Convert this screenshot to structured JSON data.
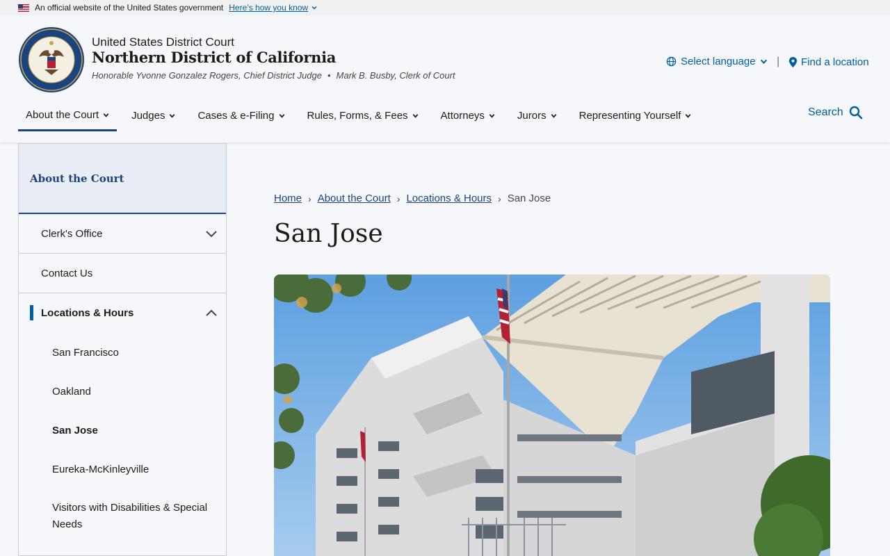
{
  "gov_banner": {
    "text": "An official website of the United States government",
    "link": "Here’s how you know"
  },
  "header": {
    "court_line": "United States District Court",
    "court_name": "Northern District of California",
    "judge": "Honorable Yvonne Gonzalez Rogers, Chief District Judge",
    "dot": "•",
    "clerk": "Mark B. Busby, Clerk of Court",
    "language": "Select language",
    "divider": "|",
    "find_location": "Find a location",
    "search": "Search"
  },
  "nav": {
    "items": [
      {
        "label": "About the Court"
      },
      {
        "label": "Judges"
      },
      {
        "label": "Cases & e-Filing"
      },
      {
        "label": "Rules, Forms, & Fees"
      },
      {
        "label": "Attorneys"
      },
      {
        "label": "Jurors"
      },
      {
        "label": "Representing Yourself"
      }
    ]
  },
  "sidebar": {
    "heading": "About the Court",
    "items": [
      {
        "label": "Clerk's Office"
      },
      {
        "label": "Contact Us"
      },
      {
        "label": "Locations & Hours"
      }
    ],
    "sub_items": [
      {
        "label": "San Francisco"
      },
      {
        "label": "Oakland"
      },
      {
        "label": "San Jose"
      },
      {
        "label": "Eureka-McKinleyville"
      },
      {
        "label": "Visitors with Disabilities & Special Needs"
      }
    ]
  },
  "breadcrumb": {
    "items": [
      "Home",
      "About the Court",
      "Locations & Hours"
    ],
    "separator": "›",
    "current": "San Jose"
  },
  "page": {
    "title": "San Jose"
  },
  "colors": {
    "link": "#005ea2",
    "navy": "#1a4480",
    "background": "#f5f7fa"
  }
}
